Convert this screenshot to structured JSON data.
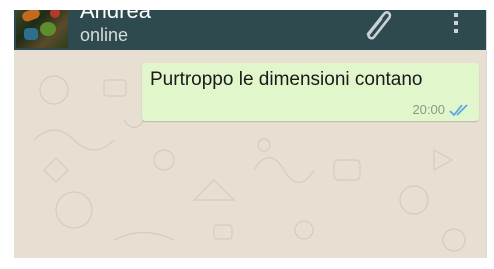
{
  "header": {
    "contact_name": "Andrea",
    "status": "online",
    "attach_icon": "paperclip-icon",
    "menu_icon": "more-vertical-icon",
    "bar_color": "#2f4a4f"
  },
  "conversation": {
    "messages": [
      {
        "text": "Purtroppo le dimensioni contano",
        "time": "20:00",
        "status_icon": "double-check-read-icon",
        "bubble_color": "#e1f7cb"
      }
    ]
  }
}
